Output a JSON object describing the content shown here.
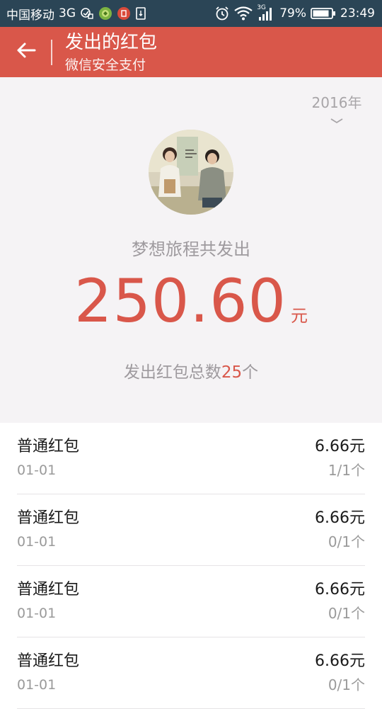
{
  "status_bar": {
    "carrier": "中国移动",
    "network": "3G",
    "signal_network": "3G",
    "battery_percent": "79%",
    "time": "23:49"
  },
  "app_bar": {
    "title": "发出的红包",
    "subtitle": "微信安全支付"
  },
  "summary": {
    "year": "2016年",
    "sender_line": "梦想旅程共发出",
    "total_amount": "250.60",
    "amount_unit": "元",
    "count_prefix": "发出红包总数",
    "count_value": "25",
    "count_suffix": "个"
  },
  "packets": [
    {
      "type": "普通红包",
      "date": "01-01",
      "amount": "6.66元",
      "claimed": "1/1个"
    },
    {
      "type": "普通红包",
      "date": "01-01",
      "amount": "6.66元",
      "claimed": "0/1个"
    },
    {
      "type": "普通红包",
      "date": "01-01",
      "amount": "6.66元",
      "claimed": "0/1个"
    },
    {
      "type": "普通红包",
      "date": "01-01",
      "amount": "6.66元",
      "claimed": "0/1个"
    }
  ],
  "colors": {
    "status_bar_bg": "#2b4556",
    "accent": "#d9574a",
    "summary_bg": "#f5f3f5",
    "muted_text": "#9e9a9e"
  },
  "icons": {
    "back": "arrow-left-icon",
    "year_dropdown": "chevron-down-icon",
    "status": [
      "sim-icon",
      "app-notification-icon",
      "record-notification-icon",
      "sim-card-icon",
      "alarm-icon",
      "wifi-icon",
      "signal-icon",
      "battery-icon"
    ]
  }
}
